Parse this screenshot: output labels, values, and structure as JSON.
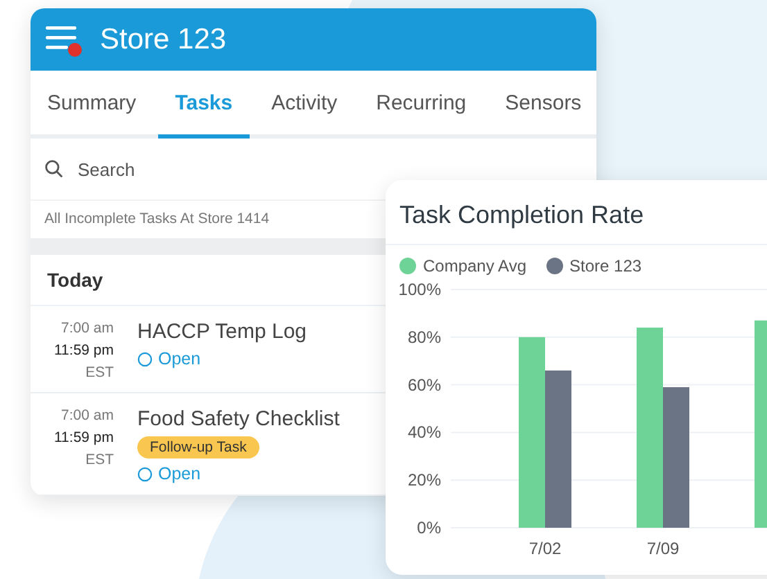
{
  "header": {
    "title": "Store 123",
    "has_notification": true
  },
  "tabs": [
    {
      "label": "Summary",
      "selected": false
    },
    {
      "label": "Tasks",
      "selected": true
    },
    {
      "label": "Activity",
      "selected": false
    },
    {
      "label": "Recurring",
      "selected": false
    },
    {
      "label": "Sensors",
      "selected": false
    }
  ],
  "search": {
    "placeholder": "Search"
  },
  "filter_label": "All Incomplete Tasks At Store 1414",
  "section_title": "Today",
  "tasks": [
    {
      "start": "7:00 am",
      "end": "11:59 pm",
      "timezone": "EST",
      "title": "HACCP Temp Log",
      "status": "Open"
    },
    {
      "start": "7:00 am",
      "end": "11:59 pm",
      "timezone": "EST",
      "title": "Food Safety Checklist",
      "tag": "Follow-up Task",
      "status": "Open"
    }
  ],
  "chart_card": {
    "title": "Task Completion Rate",
    "chart_data": {
      "type": "bar",
      "categories": [
        "7/02",
        "7/09",
        null
      ],
      "series": [
        {
          "name": "Company Avg",
          "color": "#6dd396",
          "values": [
            80,
            84,
            87
          ]
        },
        {
          "name": "Store 123",
          "color": "#6b7485",
          "values": [
            66,
            59,
            null
          ]
        }
      ],
      "ylim": [
        0,
        100
      ],
      "grid": true,
      "yticks": [
        {
          "value": 0,
          "label": "0%"
        },
        {
          "value": 20,
          "label": "20%"
        },
        {
          "value": 40,
          "label": "40%"
        },
        {
          "value": 60,
          "label": "60%"
        },
        {
          "value": 80,
          "label": "80%"
        },
        {
          "value": 100,
          "label": "100%"
        }
      ]
    }
  }
}
